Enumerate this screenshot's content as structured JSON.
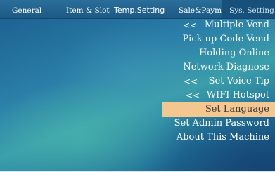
{
  "tabs": [
    {
      "label": "General"
    },
    {
      "label": "Item & Slot"
    },
    {
      "label": "Temp.Setting"
    },
    {
      "label": "Sale&Payment"
    },
    {
      "label": "Sys. Setting"
    }
  ],
  "menu": {
    "items": [
      {
        "label": "Multiple Vend",
        "arrow": "<<"
      },
      {
        "label": "Pick-up Code Vend"
      },
      {
        "label": "Holding Online"
      },
      {
        "label": "Network Diagnose"
      },
      {
        "label": "Set Voice Tip",
        "arrow": "<<"
      },
      {
        "label": "WIFI Hotspot",
        "arrow": "<<"
      },
      {
        "label": "Set Language"
      },
      {
        "label": "Set Admin Password"
      },
      {
        "label": "About This Machine"
      }
    ]
  },
  "colors": {
    "selected_background": "#f4c791",
    "active_tab_background": "#16507b",
    "background": "#2a7fa8"
  }
}
